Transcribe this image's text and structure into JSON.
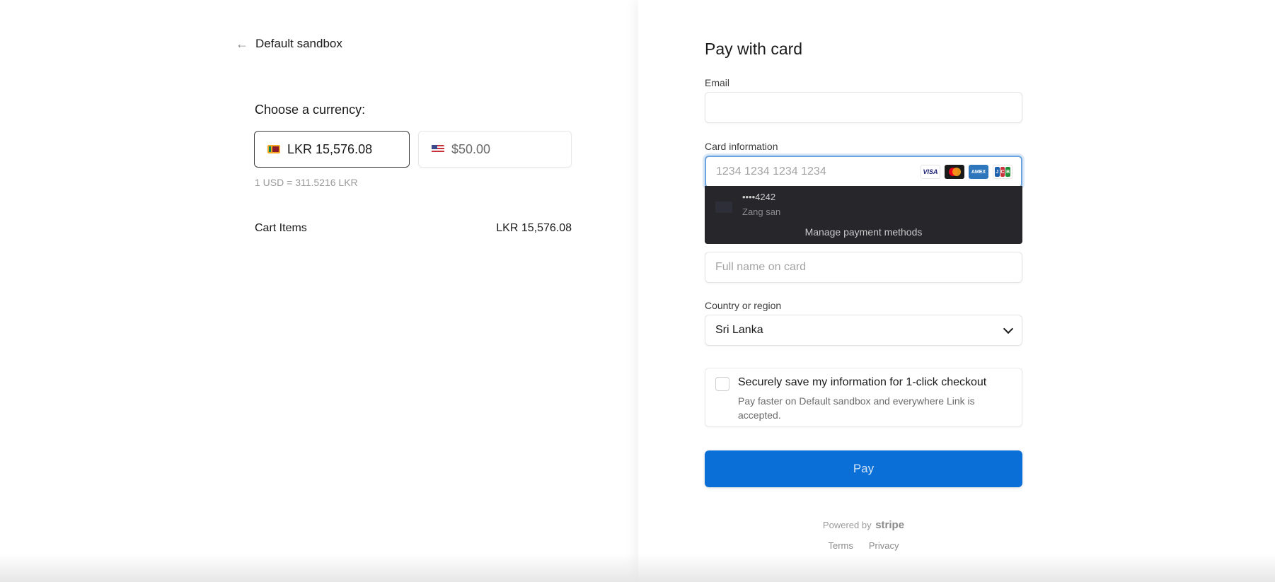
{
  "header": {
    "back_label": "Default sandbox"
  },
  "currency": {
    "heading": "Choose a currency:",
    "options": [
      {
        "label": "LKR 15,576.08",
        "flag": "lk-flag-icon",
        "selected": true
      },
      {
        "label": "$50.00",
        "flag": "us-flag-icon",
        "selected": false
      }
    ],
    "rate": "1 USD = 311.5216 LKR"
  },
  "cart": {
    "label": "Cart Items",
    "amount": "LKR 15,576.08"
  },
  "form": {
    "title": "Pay with card",
    "email_label": "Email",
    "email_value": "",
    "card_label": "Card information",
    "card_placeholder": "1234 1234 1234 1234",
    "card_brands": [
      "VISA",
      "Mastercard",
      "AMEX",
      "JCB"
    ],
    "saved_card": {
      "number": "••••4242",
      "name": "Zang san"
    },
    "manage_label": "Manage payment methods",
    "name_placeholder": "Full name on card",
    "country_label": "Country or region",
    "country_value": "Sri Lanka",
    "save_title": "Securely save my information for 1-click checkout",
    "save_desc": "Pay faster on Default sandbox and everywhere Link is accepted.",
    "pay_label": "Pay"
  },
  "footer": {
    "powered_prefix": "Powered by",
    "powered_brand": "stripe",
    "terms": "Terms",
    "privacy": "Privacy"
  },
  "colors": {
    "pay_button": "#0a6fd6",
    "dropdown_bg": "#26262b",
    "focus_ring": "#6aa3e0"
  }
}
